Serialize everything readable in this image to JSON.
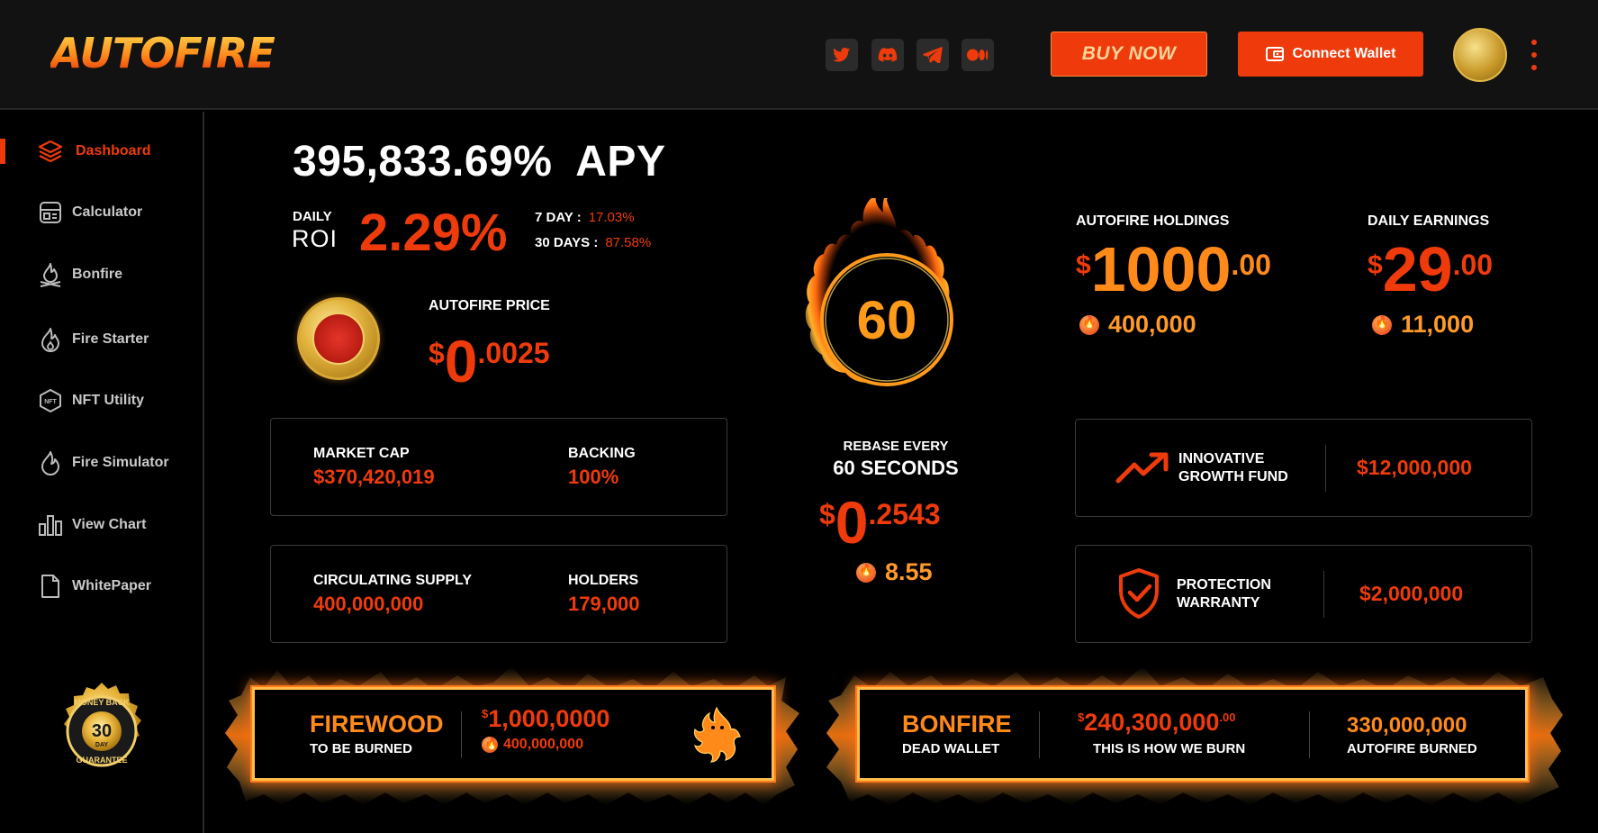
{
  "header": {
    "logo": "AUTOFIRE",
    "social": [
      "twitter-icon",
      "discord-icon",
      "telegram-icon",
      "medium-icon"
    ],
    "buy_label": "BUY NOW",
    "wallet_label": "Connect Wallet"
  },
  "sidebar": {
    "items": [
      {
        "label": "Dashboard",
        "icon": "layers-icon",
        "active": true
      },
      {
        "label": "Calculator",
        "icon": "calculator-icon"
      },
      {
        "label": "Bonfire",
        "icon": "campfire-icon"
      },
      {
        "label": "Fire Starter",
        "icon": "flame-icon"
      },
      {
        "label": "NFT Utility",
        "icon": "nft-hexagon-icon"
      },
      {
        "label": "Fire Simulator",
        "icon": "fire-icon"
      },
      {
        "label": "View Chart",
        "icon": "bar-chart-icon"
      },
      {
        "label": "WhitePaper",
        "icon": "document-icon"
      }
    ],
    "badge": {
      "top": "MONEY BACK",
      "num": "30",
      "day": "DAY",
      "bottom": "GUARANTEE"
    }
  },
  "apy": {
    "value": "395,833.69%",
    "suffix": "APY",
    "daily_label": "DAILY",
    "roi_label": "ROI",
    "roi_value": "2.29%",
    "seven_day_label": "7 DAY :",
    "seven_day_value": "17.03%",
    "thirty_days_label": "30 DAYS :",
    "thirty_days_value": "87.58%"
  },
  "price": {
    "label": "AUTOFIRE PRICE",
    "currency": "$",
    "int": "0",
    "dec": ".0025"
  },
  "stats": {
    "market_cap_label": "MARKET CAP",
    "market_cap_value": "$370,420,019",
    "backing_label": "BACKING",
    "backing_value": "100%",
    "supply_label": "CIRCULATING SUPPLY",
    "supply_value": "400,000,000",
    "holders_label": "HOLDERS",
    "holders_value": "179,000"
  },
  "rebase": {
    "countdown": "60",
    "label": "REBASE EVERY",
    "seconds": "60 SECONDS",
    "currency": "$",
    "int": "0",
    "dec": ".2543",
    "tokens": "8.55"
  },
  "holdings": {
    "label": "AUTOFIRE HOLDINGS",
    "currency": "$",
    "int": "1000",
    "dec": ".00",
    "tokens": "400,000"
  },
  "earnings": {
    "label": "DAILY EARNINGS",
    "currency": "$",
    "int": "29",
    "dec": ".00",
    "tokens": "11,000"
  },
  "features": {
    "growth_line1": "INNOVATIVE",
    "growth_line2": "GROWTH FUND",
    "growth_value": "$12,000,000",
    "protection_line1": "PROTECTION",
    "protection_line2": "WARRANTY",
    "protection_value": "$2,000,000"
  },
  "firewood": {
    "title": "FIREWOOD",
    "subtitle": "TO BE BURNED",
    "currency": "$",
    "value": "1,000,0000",
    "tokens": "400,000,000"
  },
  "bonfire": {
    "title": "BONFIRE",
    "subtitle": "DEAD WALLET",
    "currency": "$",
    "value": "240,300,000",
    "cents": ".00",
    "value_caption": "THIS IS HOW WE BURN",
    "burned_value": "330,000,000",
    "burned_caption": "AUTOFIRE BURNED"
  }
}
